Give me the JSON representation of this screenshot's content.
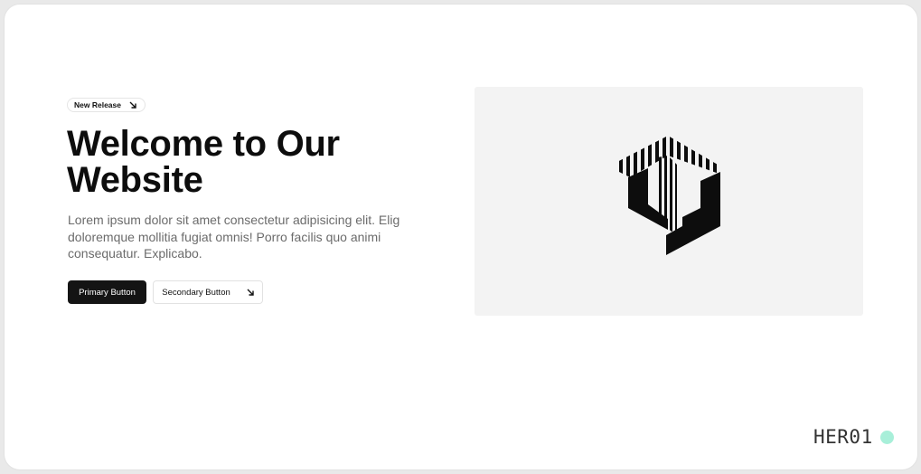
{
  "hero": {
    "badge_label": "New Release",
    "badge_icon": "arrow-down-right-icon",
    "title": "Welcome to Our Website",
    "description": "Lorem ipsum dolor sit amet consectetur adipisicing elit. Elig doloremque mollitia fugiat omnis! Porro facilis quo animi consequatur. Explicabo.",
    "primary_button": "Primary Button",
    "secondary_button": "Secondary Button",
    "secondary_button_icon": "arrow-down-right-icon",
    "image_logo": "striped-hexagon-logo"
  },
  "tag": {
    "label": "HER01",
    "dot_color": "#a8efd9"
  },
  "colors": {
    "primary": "#141414",
    "text": "#0d0d0d",
    "muted": "#6b6b6b",
    "image_bg": "#f3f3f3"
  }
}
